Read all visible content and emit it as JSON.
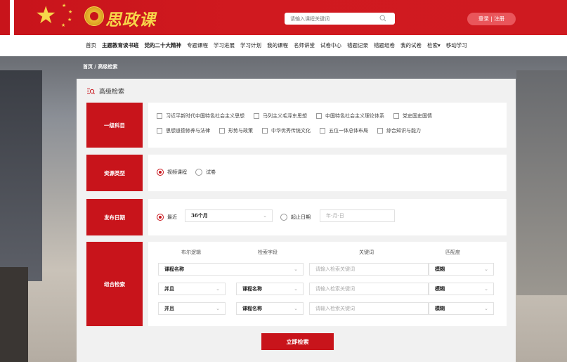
{
  "header": {
    "logo_text": "思政课",
    "search_placeholder": "请输入课程关键词",
    "login_label": "登录 | 注册"
  },
  "nav": [
    {
      "label": "首页",
      "bold": false
    },
    {
      "label": "主题教育读书班",
      "bold": true
    },
    {
      "label": "党的二十大精神",
      "bold": true
    },
    {
      "label": "专题课程",
      "bold": false
    },
    {
      "label": "学习进展",
      "bold": false
    },
    {
      "label": "学习计划",
      "bold": false
    },
    {
      "label": "我的课程",
      "bold": false
    },
    {
      "label": "名师讲堂",
      "bold": false
    },
    {
      "label": "试卷中心",
      "bold": false
    },
    {
      "label": "错题记录",
      "bold": false
    },
    {
      "label": "错题组卷",
      "bold": false
    },
    {
      "label": "我的试卷",
      "bold": false
    },
    {
      "label": "检索▾",
      "bold": false
    },
    {
      "label": "移动学习",
      "bold": false
    }
  ],
  "breadcrumb": "首页 / 高级检索",
  "panel": {
    "title": "高级检索",
    "subject": {
      "label": "一级科目",
      "options_row1": [
        "习近平新时代中国特色社会主义思想",
        "马列主义毛泽东思想",
        "中国特色社会主义理论体系",
        "党史国史国情"
      ],
      "options_row2": [
        "思想道德修养与法律",
        "形势与政策",
        "中华优秀传统文化",
        "五位一体总体布局",
        "综合知识与能力"
      ]
    },
    "resource": {
      "label": "资源类型",
      "options": [
        {
          "label": "视频课程",
          "checked": true
        },
        {
          "label": "试卷",
          "checked": false
        }
      ]
    },
    "date": {
      "label": "发布日期",
      "recent_label": "最近",
      "recent_value": "36个月",
      "range_label": "起止日期",
      "range_placeholder": "年-月-日"
    },
    "combo": {
      "label": "组合检索",
      "headers": [
        "布尔逻辑",
        "检索字段",
        "关键词",
        "匹配度"
      ],
      "rows": [
        {
          "logic": "",
          "field": "课程名称",
          "keyword_placeholder": "请输入检索关键词",
          "match": "模糊"
        },
        {
          "logic": "并且",
          "field": "课程名称",
          "keyword_placeholder": "请输入检索关键词",
          "match": "模糊"
        },
        {
          "logic": "并且",
          "field": "课程名称",
          "keyword_placeholder": "请输入检索关键词",
          "match": "模糊"
        }
      ]
    },
    "submit_label": "立即检索"
  }
}
